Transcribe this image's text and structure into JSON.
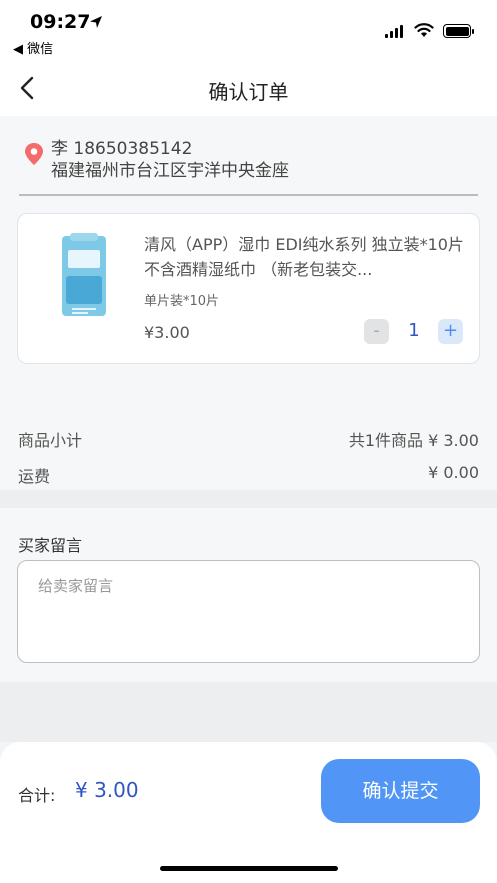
{
  "status_bar": {
    "time": "09:27",
    "back_app": "◀ 微信"
  },
  "nav": {
    "title": "确认订单"
  },
  "address": {
    "name_phone": "李 18650385142",
    "full": "福建福州市台江区宇洋中央金座"
  },
  "goods": {
    "title": "清风（APP）湿巾 EDI纯水系列 独立装*10片 不含酒精湿纸巾 （新老包装交...",
    "spec": "单片装*10片",
    "price": "¥3.00",
    "quantity": "1",
    "minus": "-",
    "plus": "+"
  },
  "summary": {
    "subtotal_label": "商品小计",
    "subtotal_value": "共1件商品 ¥ 3.00",
    "shipping_label": "运费",
    "shipping_value": "¥ 0.00"
  },
  "memo": {
    "label": "买家留言",
    "placeholder": "给卖家留言",
    "value": ""
  },
  "footer": {
    "total_label": "合计:",
    "total_value": "¥ 3.00",
    "submit_label": "确认提交"
  },
  "colors": {
    "accent": "#5196f7",
    "price_blue": "#2f55c6",
    "pin": "#f36b6b"
  }
}
